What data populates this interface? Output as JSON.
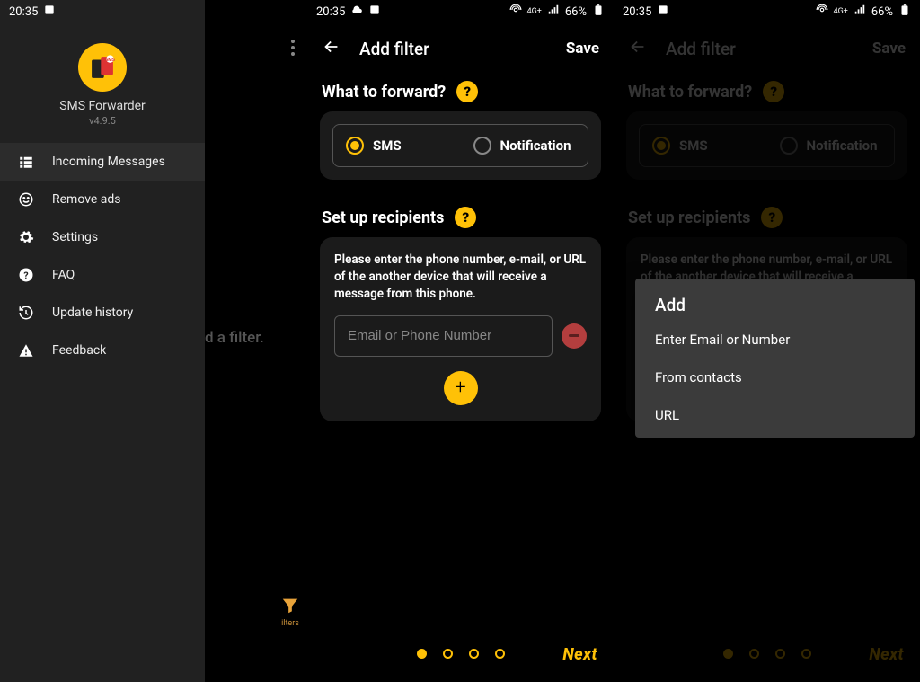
{
  "status": {
    "time": "20:35",
    "battery": "66%",
    "signal_label": "4G+"
  },
  "drawer": {
    "app_name": "SMS Forwarder",
    "version": "v4.9.5",
    "items": [
      {
        "label": "Incoming Messages",
        "icon": "list-icon",
        "active": true
      },
      {
        "label": "Remove ads",
        "icon": "smile-icon"
      },
      {
        "label": "Settings",
        "icon": "gear-icon"
      },
      {
        "label": "FAQ",
        "icon": "help-icon"
      },
      {
        "label": "Update history",
        "icon": "history-icon"
      },
      {
        "label": "Feedback",
        "icon": "warning-icon"
      }
    ],
    "behind_text": "d a filter.",
    "filters_fab_label": "ilters"
  },
  "addfilter": {
    "title": "Add filter",
    "save": "Save",
    "what_title": "What to forward?",
    "option_sms": "SMS",
    "option_notification": "Notification",
    "recipients_title": "Set up recipients",
    "recipients_help": "Please enter the phone number, e-mail, or URL of the another device that will receive a message from this phone.",
    "input_placeholder": "Email or Phone Number",
    "next": "Next",
    "page_index": 0,
    "page_count": 4
  },
  "popup": {
    "title": "Add",
    "items": [
      "Enter Email or Number",
      "From contacts",
      "URL"
    ]
  }
}
